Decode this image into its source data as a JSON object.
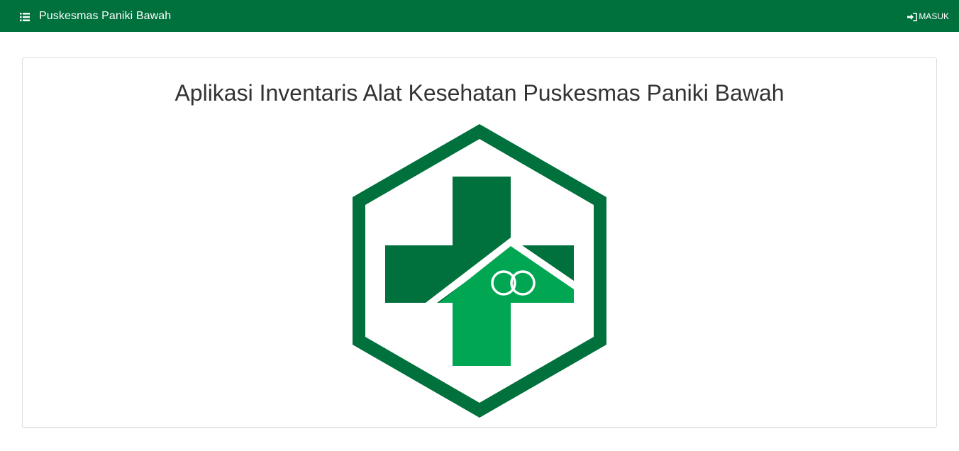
{
  "navbar": {
    "brand_icon": "list-icon",
    "brand_text": "Puskesmas Paniki Bawah",
    "login_icon": "sign-in-icon",
    "login_text": "MASUK",
    "background_color": "#00703c"
  },
  "main": {
    "title": "Aplikasi Inventaris Alat Kesehatan Puskesmas Paniki Bawah",
    "logo": {
      "name": "puskesmas-logo",
      "dark_green": "#00703c",
      "light_green": "#00a651"
    }
  }
}
